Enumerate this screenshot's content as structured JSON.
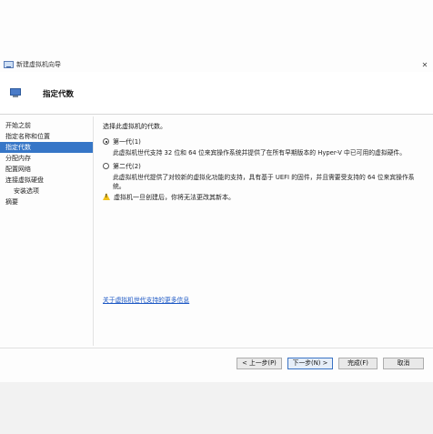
{
  "window": {
    "title": "新建虚拟机向导",
    "close_glyph": "✕"
  },
  "header": {
    "title": "指定代数",
    "icon": "vm-monitor-icon"
  },
  "nav": {
    "items": [
      {
        "label": "开始之前"
      },
      {
        "label": "指定名称和位置"
      },
      {
        "label": "指定代数"
      },
      {
        "label": "分配内存"
      },
      {
        "label": "配置网络"
      },
      {
        "label": "连接虚拟硬盘"
      },
      {
        "label": "安装选项"
      },
      {
        "label": "摘要"
      }
    ],
    "selected_index": 2
  },
  "content": {
    "prompt": "选择此虚拟机的代数。",
    "gen1": {
      "label": "第一代(1)",
      "selected": true,
      "description": "此虚拟机世代支持 32 位和 64 位来宾操作系统并提供了在所有早期版本的 Hyper-V 中已可用的虚拟硬件。"
    },
    "gen2": {
      "label": "第二代(2)",
      "selected": false,
      "description": "此虚拟机世代提供了对较新的虚拟化功能的支持，具有基于 UEFI 的固件，并且需要受支持的 64 位来宾操作系统。"
    },
    "warning": "虚拟机一旦创建后，你将无法更改其新本。",
    "more_link": "关于虚拟机世代支持的更多信息"
  },
  "buttons": {
    "prev": "< 上一步(P)",
    "next": "下一步(N) >",
    "finish": "完成(F)",
    "cancel": "取消"
  },
  "colors": {
    "selected_nav": "#3676c7",
    "link": "#1a56c4",
    "warning": "#f2c21a"
  }
}
